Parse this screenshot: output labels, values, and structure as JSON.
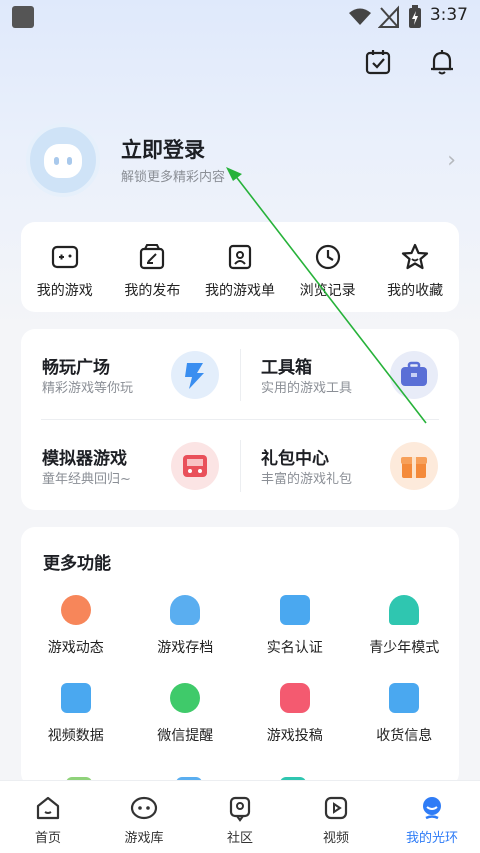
{
  "status_bar": {
    "time": "3:37"
  },
  "profile": {
    "title": "立即登录",
    "subtitle": "解锁更多精彩内容"
  },
  "quick_actions": [
    {
      "label": "我的游戏",
      "icon": "gamepad-icon"
    },
    {
      "label": "我的发布",
      "icon": "edit-box-icon"
    },
    {
      "label": "我的游戏单",
      "icon": "game-list-icon"
    },
    {
      "label": "浏览记录",
      "icon": "clock-icon"
    },
    {
      "label": "我的收藏",
      "icon": "star-icon"
    }
  ],
  "features": [
    {
      "title": "畅玩广场",
      "desc": "精彩游戏等你玩",
      "icon": "lightning-icon"
    },
    {
      "title": "工具箱",
      "desc": "实用的游戏工具",
      "icon": "toolbox-icon"
    },
    {
      "title": "模拟器游戏",
      "desc": "童年经典回归~",
      "icon": "emulator-icon"
    },
    {
      "title": "礼包中心",
      "desc": "丰富的游戏礼包",
      "icon": "gift-icon"
    }
  ],
  "more": {
    "title": "更多功能",
    "items": [
      {
        "label": "游戏动态",
        "icon": "game-news-icon",
        "color": "#f7865a"
      },
      {
        "label": "游戏存档",
        "icon": "cloud-upload-icon",
        "color": "#5aaef0"
      },
      {
        "label": "实名认证",
        "icon": "id-card-icon",
        "color": "#4aa8f0"
      },
      {
        "label": "青少年模式",
        "icon": "umbrella-icon",
        "color": "#2fc6b0"
      },
      {
        "label": "视频数据",
        "icon": "video-stats-icon",
        "color": "#4aa8f0"
      },
      {
        "label": "微信提醒",
        "icon": "wechat-bubble-icon",
        "color": "#3fca6a"
      },
      {
        "label": "游戏投稿",
        "icon": "game-submit-icon",
        "color": "#f45a70"
      },
      {
        "label": "收货信息",
        "icon": "delivery-box-icon",
        "color": "#4aa8f0"
      }
    ]
  },
  "bottom_nav": [
    {
      "label": "首页",
      "icon": "home-icon"
    },
    {
      "label": "游戏库",
      "icon": "game-library-icon"
    },
    {
      "label": "社区",
      "icon": "community-icon"
    },
    {
      "label": "视频",
      "icon": "video-play-icon"
    },
    {
      "label": "我的光环",
      "icon": "profile-icon",
      "active": true
    }
  ],
  "colors": {
    "accent": "#2f7cf6",
    "annotation_arrow": "#27b23a"
  }
}
